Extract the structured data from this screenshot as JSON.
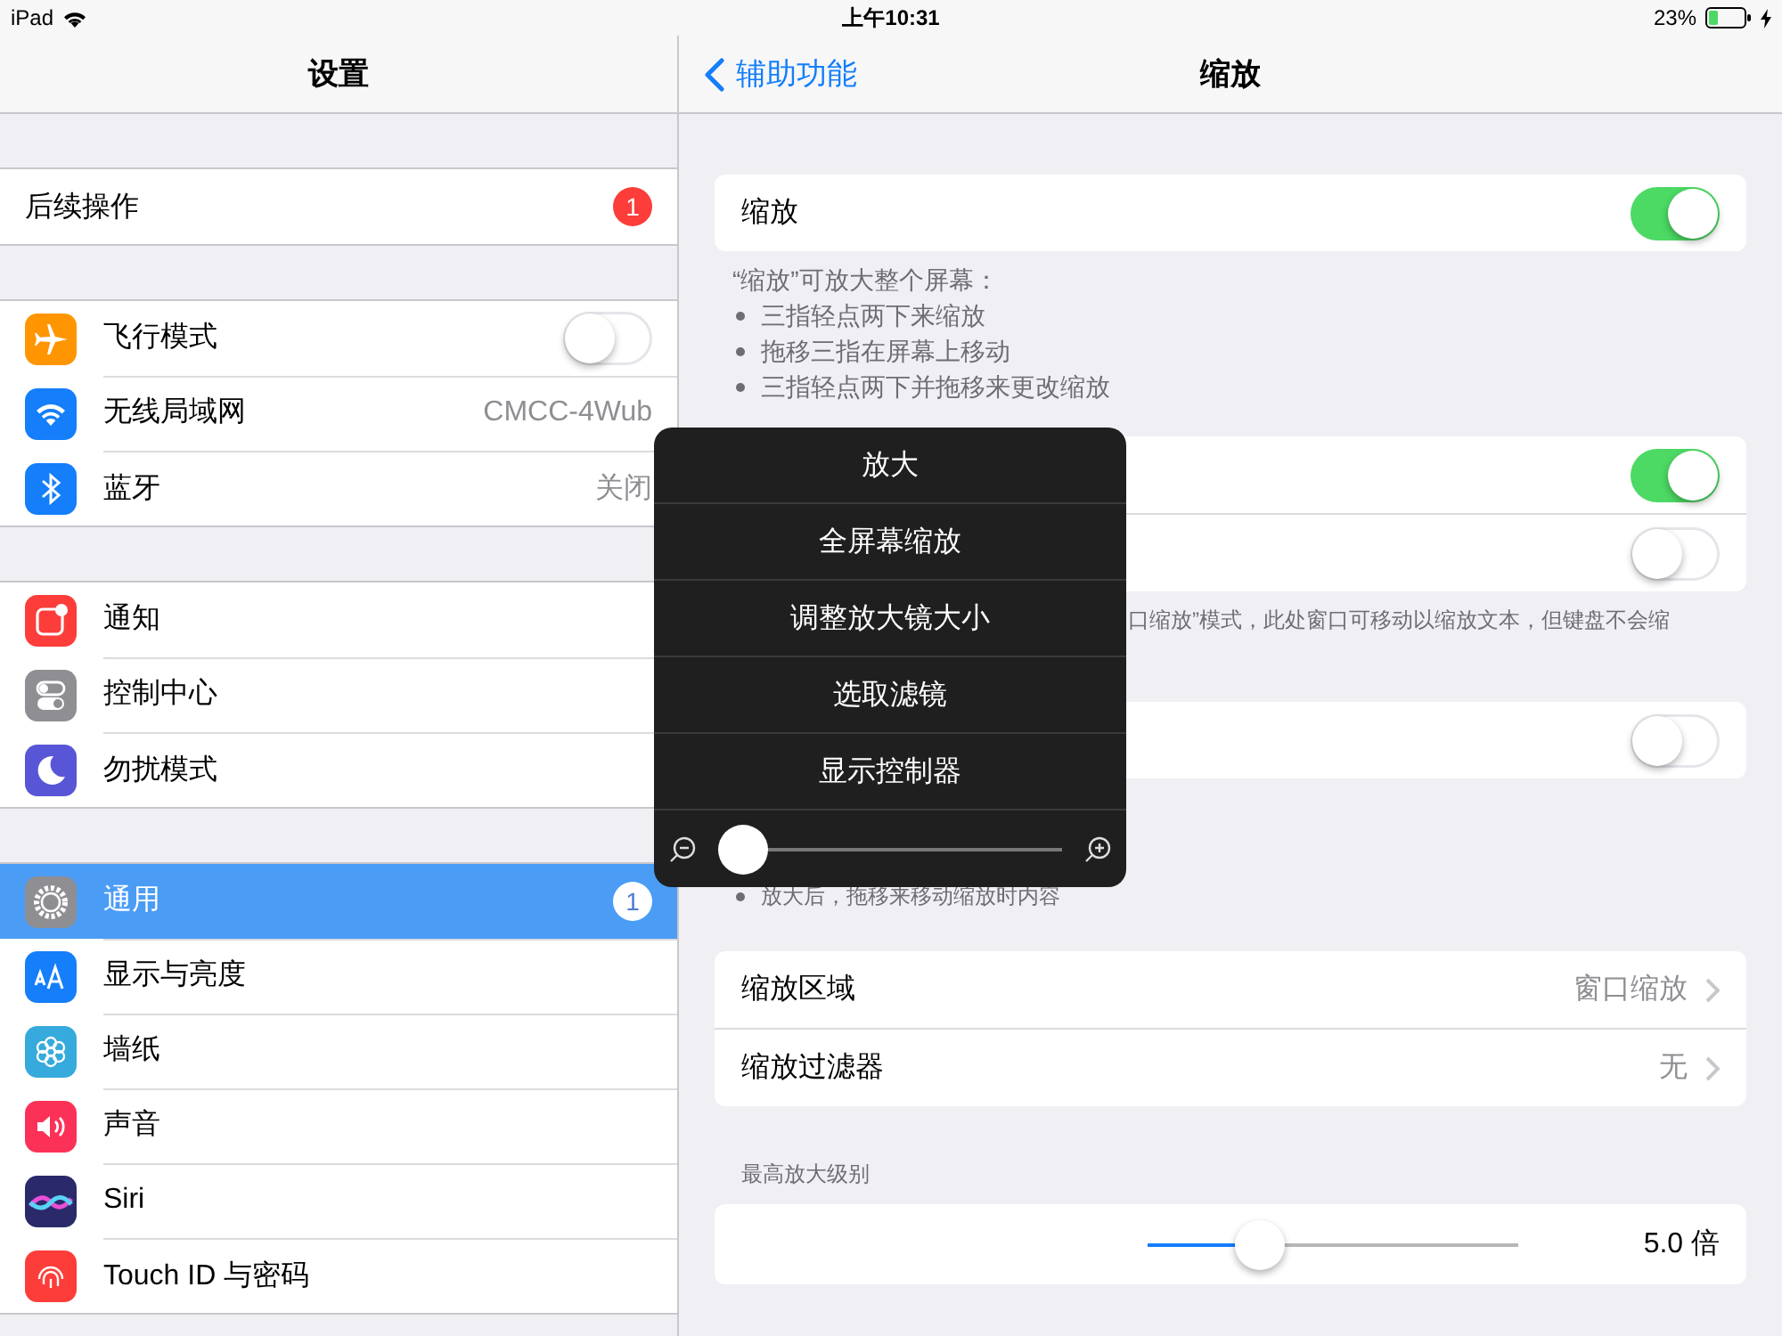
{
  "status_bar": {
    "device": "iPad",
    "time": "上午10:31",
    "battery": "23%"
  },
  "sidebar": {
    "title": "设置",
    "groups": [
      [
        {
          "label": "后续操作",
          "kind": "badge",
          "badge": "1",
          "selected": false
        }
      ],
      [
        {
          "label": "飞行模式",
          "kind": "toggle",
          "on": false,
          "color": "#ff9500",
          "selected": false
        },
        {
          "label": "无线局域网",
          "kind": "value",
          "value": "CMCC-4Wub",
          "color": "#147efb",
          "selected": false
        },
        {
          "label": "蓝牙",
          "kind": "value",
          "value": "关闭",
          "color": "#147efb",
          "selected": false
        }
      ],
      [
        {
          "label": "通知",
          "kind": "plain",
          "color": "#fc3d39",
          "selected": false
        },
        {
          "label": "控制中心",
          "kind": "plain",
          "color": "#8e8e93",
          "selected": false
        },
        {
          "label": "勿扰模式",
          "kind": "plain",
          "color": "#5856d6",
          "selected": false
        }
      ],
      [
        {
          "label": "通用",
          "kind": "badge",
          "badge": "1",
          "color": "#8e8e93",
          "selected": true
        },
        {
          "label": "显示与亮度",
          "kind": "plain",
          "color": "#147efb",
          "selected": false
        },
        {
          "label": "墙纸",
          "kind": "plain",
          "color": "#36aadc",
          "selected": false
        },
        {
          "label": "声音",
          "kind": "plain",
          "color": "#fc3158",
          "selected": false
        },
        {
          "label": "Siri",
          "kind": "plain",
          "color": "#2a2a6a",
          "selected": false
        },
        {
          "label": "Touch ID 与密码",
          "kind": "plain",
          "color": "#fc3d39",
          "selected": false
        }
      ]
    ]
  },
  "detail": {
    "back": "辅助功能",
    "title": "缩放",
    "sections": [
      {
        "rows": [
          {
            "kind": "toggle",
            "label": "缩放",
            "on": true
          }
        ],
        "footer": [
          {
            "kind": "text",
            "text": "“缩放”可放大整个屏幕："
          },
          {
            "kind": "bullet",
            "text": "三指轻点两下来缩放"
          },
          {
            "kind": "bullet",
            "text": "拖移三指在屏幕上移动"
          },
          {
            "kind": "bullet",
            "text": "三指轻点两下并拖移来更改缩放"
          }
        ]
      },
      {
        "rows": [
          {
            "kind": "toggle",
            "on": true
          },
          {
            "kind": "toggle",
            "on": false
          }
        ],
        "footer": [
          {
            "kind": "covered",
            "text": "口缩放”模式，此处窗口可移动以缩放文本，但键盘不会缩"
          }
        ]
      },
      {
        "rows": [
          {
            "kind": "toggle",
            "on": false
          }
        ],
        "footer": [
          {
            "kind": "bullet",
            "text": "放大后，拖移来移动缩放时内容"
          }
        ]
      },
      {
        "rows": [
          {
            "kind": "value",
            "label": "缩放区域",
            "value": "窗口缩放"
          },
          {
            "kind": "value",
            "label": "缩放过滤器",
            "value": "无"
          }
        ]
      },
      {
        "header": "最高放大级别",
        "rows": [
          {
            "kind": "slider",
            "level": 0.27,
            "reading": "5.0 倍"
          }
        ]
      }
    ]
  },
  "popup": {
    "items": [
      "放大",
      "全屏幕缩放",
      "调整放大镜大小",
      "选取滤镜",
      "显示控制器"
    ],
    "slider": {
      "level": 0
    }
  }
}
